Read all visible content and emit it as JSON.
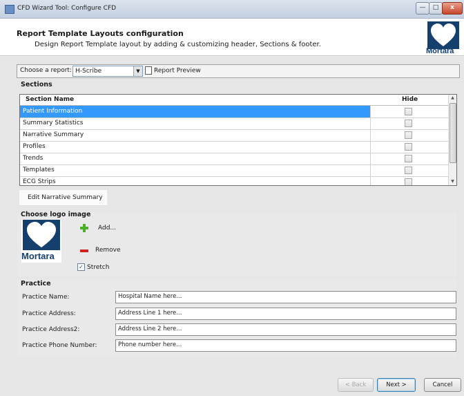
{
  "window": {
    "title": "CFD Wizard Tool: Configure CFD",
    "controls": {
      "minimize": "—",
      "maximize": "□",
      "close": "x"
    }
  },
  "header": {
    "title": "Report Template Layouts configuration",
    "subtitle": "Design Report Template layout by adding & customizing header, Sections & footer.",
    "brand": "Mortara",
    "brand_color": "#15406e"
  },
  "toolbar": {
    "choose_label": "Choose a report:",
    "report_selected": "H-Scribe",
    "preview_label": "Report Preview"
  },
  "sections": {
    "title": "Sections",
    "columns": [
      "Section Name",
      "Hide"
    ],
    "rows": [
      {
        "name": "Patient Information",
        "hidden": false,
        "selected": true
      },
      {
        "name": "Summary Statistics",
        "hidden": false
      },
      {
        "name": "Narrative Summary",
        "hidden": false
      },
      {
        "name": "Profiles",
        "hidden": false
      },
      {
        "name": "Trends",
        "hidden": false
      },
      {
        "name": "Templates",
        "hidden": false
      },
      {
        "name": "ECG Strips",
        "hidden": false
      }
    ],
    "edit_button": "Edit Narrative Summary",
    "selection_color": "#3399ff"
  },
  "logo": {
    "title": "Choose logo image",
    "add_label": "Add...",
    "remove_label": "Remove",
    "stretch_label": "Stretch",
    "stretch_checked": true,
    "brand": "Mortara"
  },
  "practice": {
    "title": "Practice",
    "fields": [
      {
        "label": "Practice Name:",
        "placeholder": "Hospital Name here..."
      },
      {
        "label": "Practice Address:",
        "placeholder": "Address Line 1 here..."
      },
      {
        "label": "Practice Address2:",
        "placeholder": "Address Line 2 here..."
      },
      {
        "label": "Practice Phone Number:",
        "placeholder": "Phone number here..."
      }
    ]
  },
  "footer": {
    "back": "< Back",
    "next": "Next >",
    "cancel": "Cancel"
  }
}
